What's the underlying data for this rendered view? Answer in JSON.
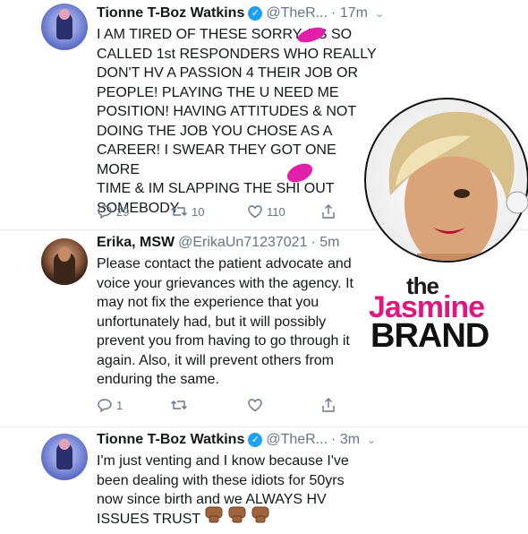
{
  "tweets": [
    {
      "name": "Tionne T-Boz Watkins",
      "verified_glyph": "✓",
      "handle": "@TheR...",
      "time": "· 17m",
      "text": "I AM TIRED OF THESE SORRY A  S SO\nCALLED 1st RESPONDERS WHO REALLY\nDON'T HV A PASSION 4 THEIR JOB OR\nPEOPLE! PLAYING THE U NEED ME\nPOSITION! HAVING ATTITUDES & NOT\nDOING THE JOB YOU CHOSE AS A\nCAREER! I SWEAR THEY GOT ONE MORE\nTIME & IM SLAPPING THE SHI  OUT\nSOMEBODY",
      "replies": "29",
      "retweets": "10",
      "likes": "110"
    },
    {
      "name": "Erika, MSW",
      "handle": "@ErikaUn71237021",
      "time": "· 5m",
      "text": "Please contact the patient advocate and\nvoice your grievances with the agency. It\nmay not fix the experience that you\nunfortunately had, but it will possibly\nprevent you from having to go through it\nagain. Also, it will prevent others from\nenduring the same.",
      "replies": "1",
      "retweets": "",
      "likes": ""
    },
    {
      "name": "Tionne T-Boz Watkins",
      "verified_glyph": "✓",
      "handle": "@TheR...",
      "time": "· 3m",
      "text": "I'm just venting and I know because I've\nbeen dealing with these idiots for 50yrs\nnow since birth and we ALWAYS HV\nISSUES TRUST"
    }
  ],
  "watermark": {
    "the": "the",
    "jasmine": "Jasmine",
    "brand": "BRAND"
  },
  "colors": {
    "accent": "#1da1f2",
    "watermark_pink": "#e0177e",
    "scribble": "#e020a8"
  }
}
